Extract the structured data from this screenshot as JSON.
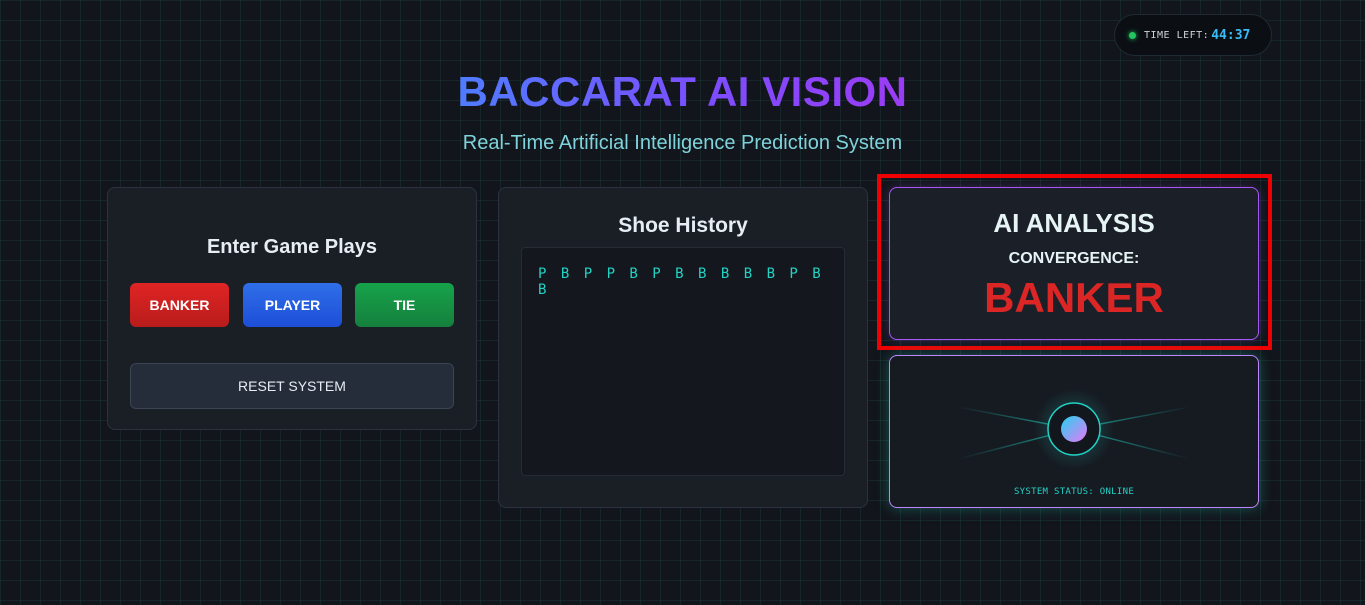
{
  "timer": {
    "label": "TIME LEFT:",
    "value": "44:37"
  },
  "header": {
    "title": "BACCARAT AI VISION",
    "subtitle": "Real-Time Artificial Intelligence Prediction System"
  },
  "plays": {
    "heading": "Enter Game Plays",
    "banker_label": "BANKER",
    "player_label": "PLAYER",
    "tie_label": "TIE",
    "reset_label": "RESET SYSTEM"
  },
  "history": {
    "heading": "Shoe History",
    "sequence": "P B P P B P B B B B B P B B"
  },
  "analysis": {
    "heading": "AI ANALYSIS",
    "subheading": "CONVERGENCE:",
    "result": "BANKER"
  },
  "status": {
    "text": "SYSTEM STATUS: ONLINE",
    "icon": "ai-orb-icon"
  },
  "colors": {
    "banker": "#dc2626",
    "player": "#2563eb",
    "tie": "#16a34a",
    "accent_cyan": "#22d3c5",
    "accent_purple": "#a855f7",
    "highlight": "#f00000"
  }
}
